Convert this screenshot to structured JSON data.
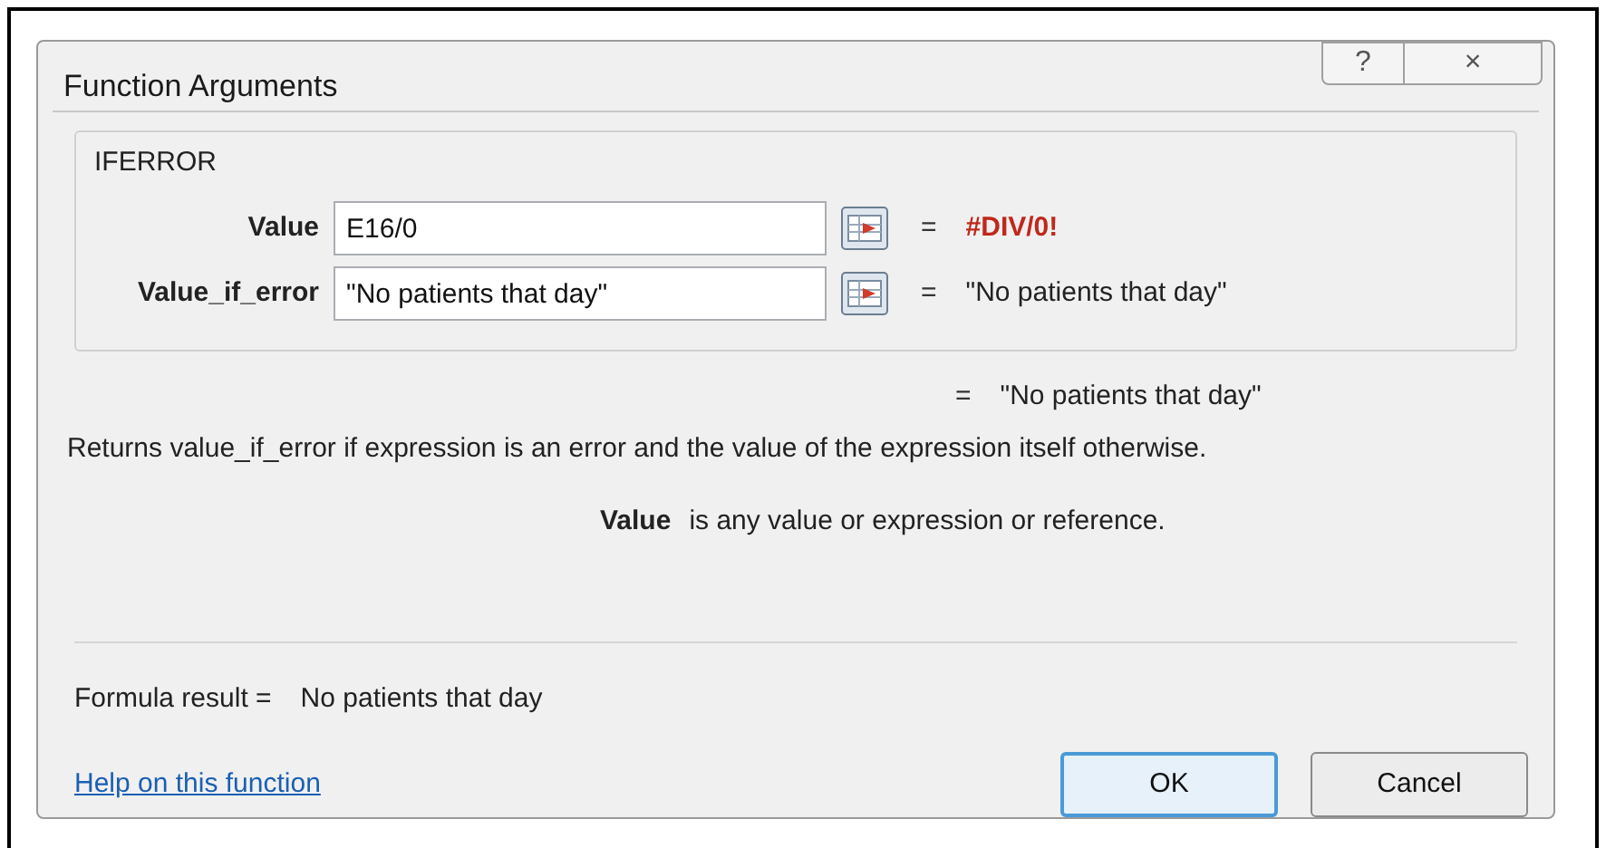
{
  "window": {
    "title": "Function Arguments",
    "buttons": [
      "?",
      "×"
    ]
  },
  "function_name": "IFERROR",
  "arguments": [
    {
      "label": "Value",
      "value": "E16/0",
      "equals": "=",
      "result": "#DIV/0!",
      "is_error": true
    },
    {
      "label": "Value_if_error",
      "value": "\"No patients that day\"",
      "equals": "=",
      "result": "\"No patients that day\"",
      "is_error": false
    }
  ],
  "overall": {
    "equals": "=",
    "result": "\"No patients that day\""
  },
  "description": "Returns value_if_error if expression is an error and the value of the expression itself otherwise.",
  "argument_help": {
    "name": "Value",
    "text": "is any value or expression or reference."
  },
  "formula_result": {
    "label": "Formula result =",
    "value": "No patients that day"
  },
  "help_link": "Help on this function",
  "buttons": [
    {
      "label": "OK",
      "default": true
    },
    {
      "label": "Cancel",
      "default": false
    }
  ]
}
